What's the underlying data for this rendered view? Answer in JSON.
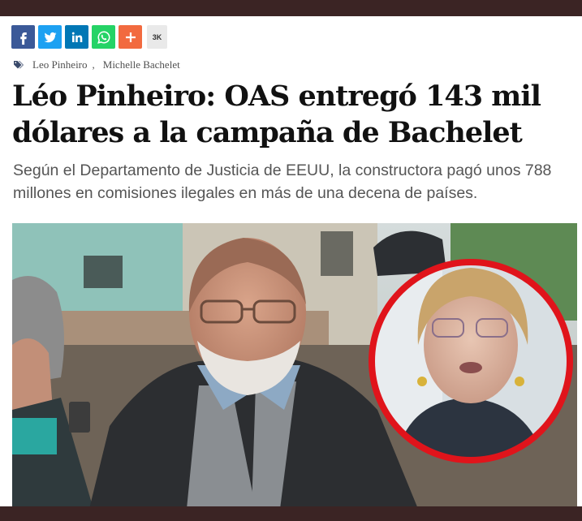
{
  "share": {
    "buttons": [
      {
        "name": "facebook-share-button",
        "icon": "facebook-icon",
        "color": "#3b5998"
      },
      {
        "name": "twitter-share-button",
        "icon": "twitter-icon",
        "color": "#1da1f2"
      },
      {
        "name": "linkedin-share-button",
        "icon": "linkedin-icon",
        "color": "#0077b5"
      },
      {
        "name": "whatsapp-share-button",
        "icon": "whatsapp-icon",
        "color": "#25d366"
      },
      {
        "name": "more-share-button",
        "icon": "plus-icon",
        "color": "#f26a3f"
      }
    ],
    "count": "3K"
  },
  "tags": {
    "icon": "tag-icon",
    "items": [
      "Leo Pinheiro",
      "Michelle Bachelet"
    ],
    "separator": ","
  },
  "article": {
    "headline": "Léo Pinheiro: OAS entregó 143 mil dólares a la campaña de Bachelet",
    "subtitle": "Según el Departamento de Justicia de EEUU, la constructora pagó unos 788 millones en comisiones ilegales en más de una decena de países."
  },
  "photo": {
    "accent_color": "#e0141b"
  }
}
